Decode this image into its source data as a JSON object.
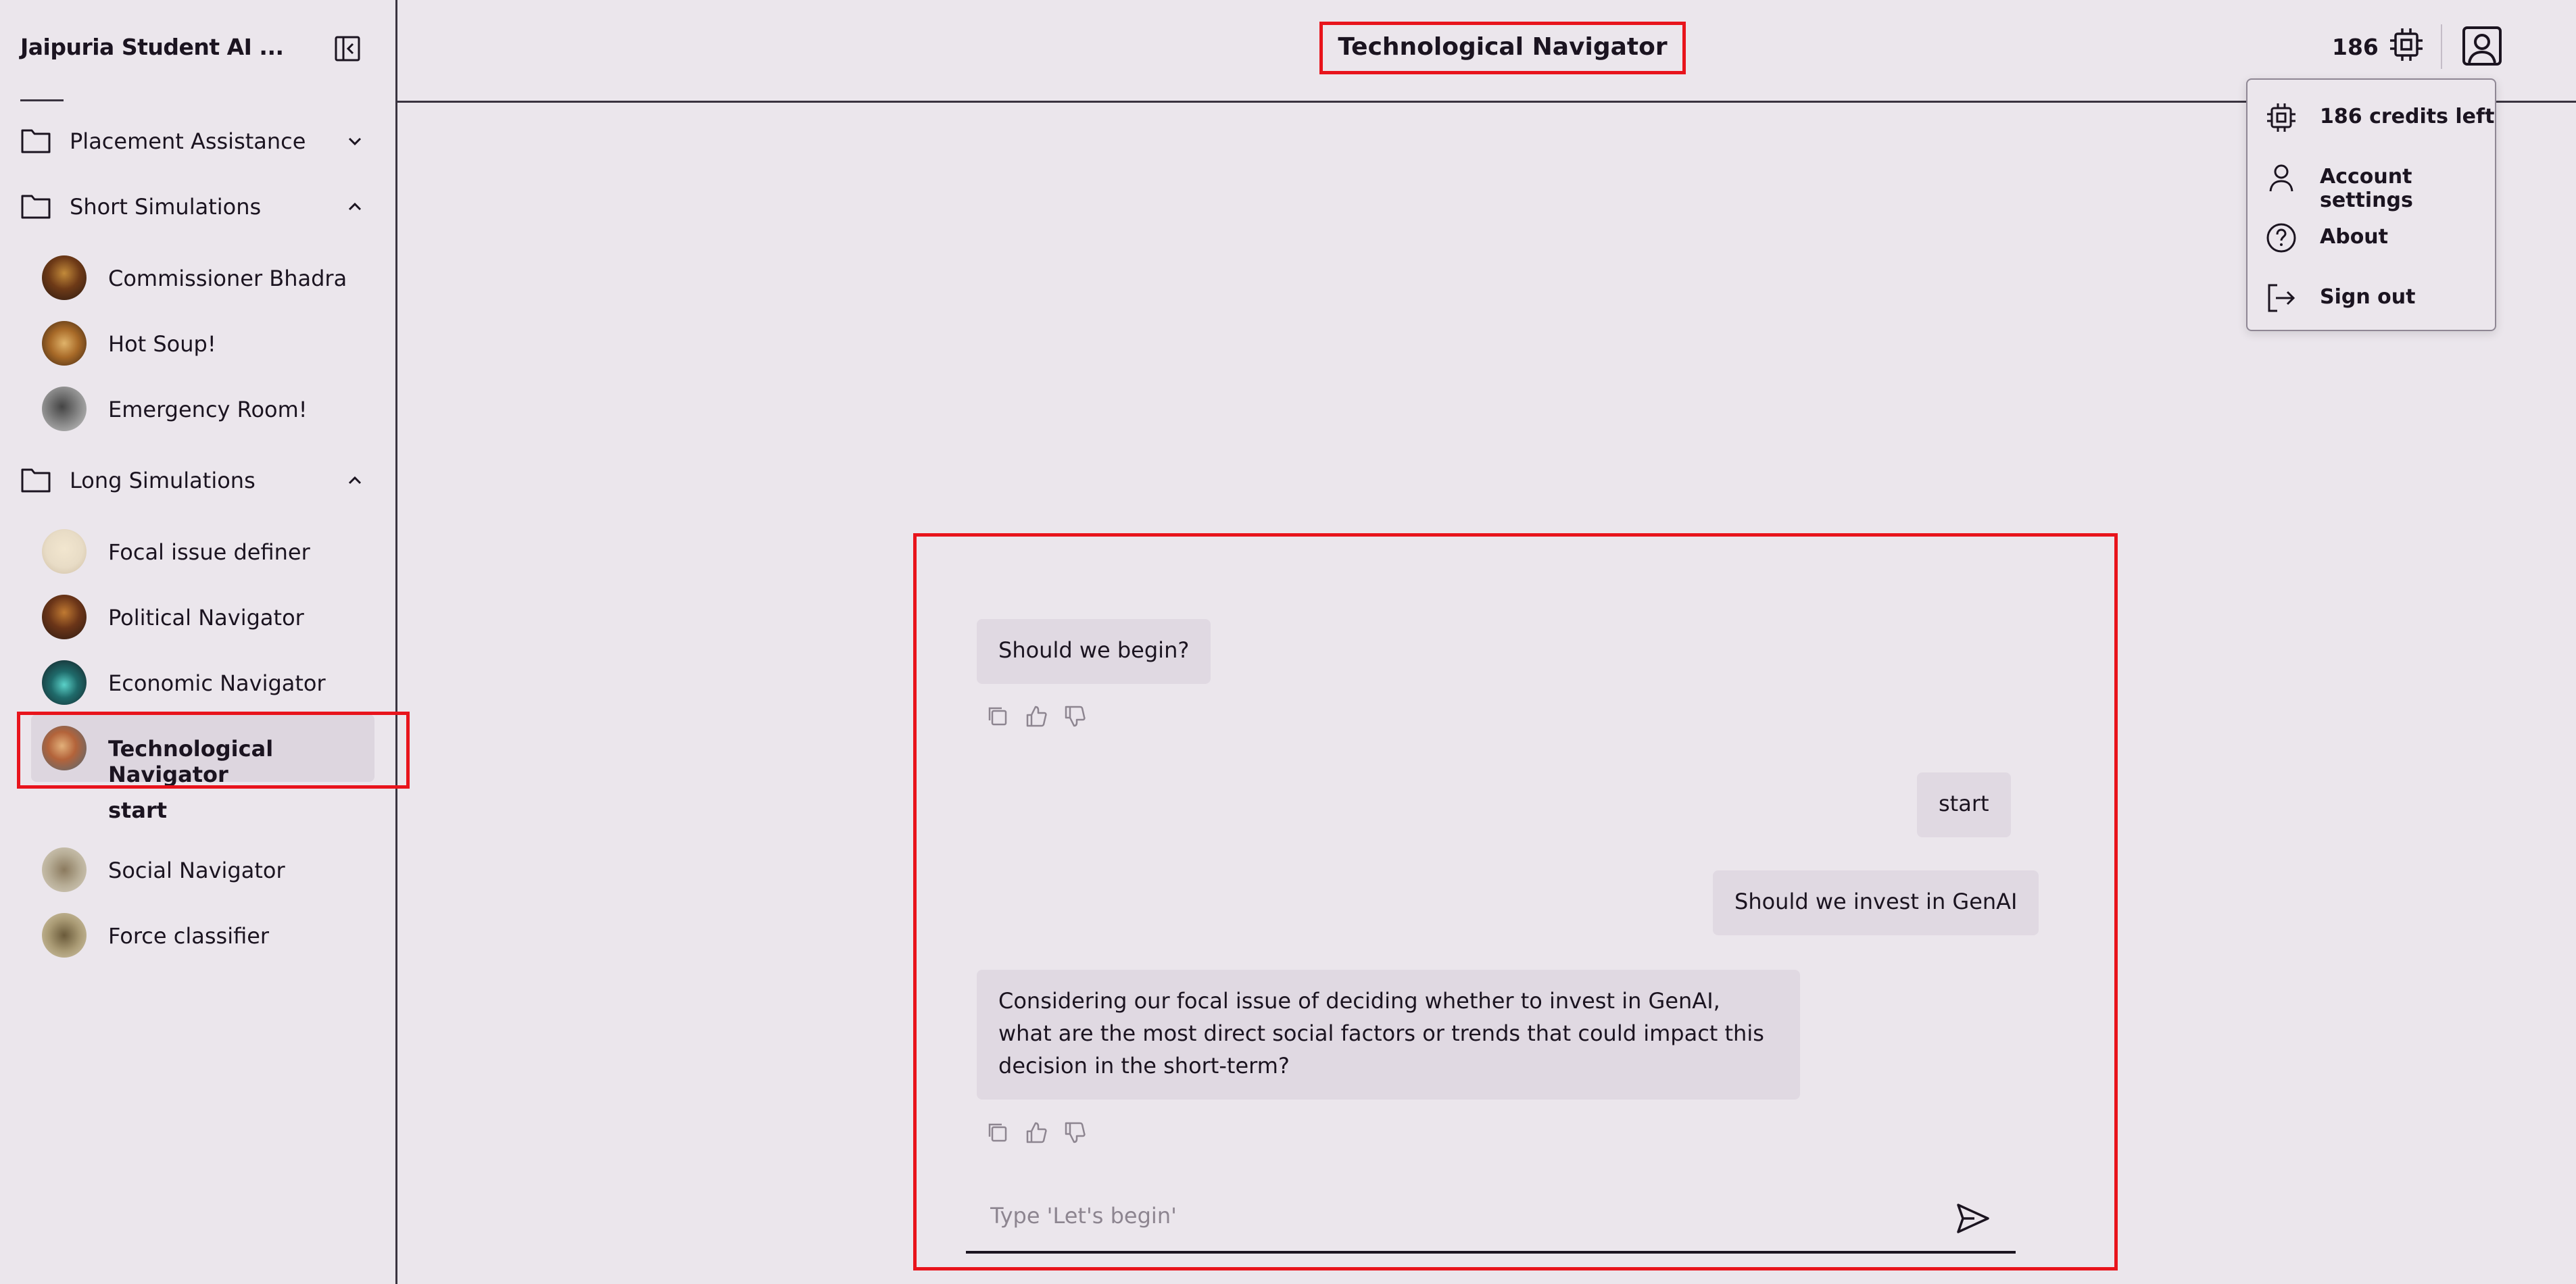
{
  "sidebar": {
    "app_title": "Jaipuria Student AI ...",
    "folders": [
      {
        "label": "Placement Assistance",
        "chevron": "chevron-down-icon"
      },
      {
        "label": "Short Simulations",
        "chevron": "chevron-up-icon"
      },
      {
        "label": "Long Simulations",
        "chevron": "chevron-up-icon"
      }
    ],
    "short_simulations": [
      {
        "label": "Commissioner Bhadra"
      },
      {
        "label": "Hot Soup!"
      },
      {
        "label": "Emergency Room!"
      }
    ],
    "long_simulations": [
      {
        "label": "Focal issue definer"
      },
      {
        "label": "Political Navigator"
      },
      {
        "label": "Economic Navigator"
      },
      {
        "label": "Technological Navigator",
        "active": true
      },
      {
        "label": "Social Navigator"
      },
      {
        "label": "Force classifier"
      }
    ],
    "active_sub_item": "start"
  },
  "header": {
    "title": "Technological Navigator",
    "credits_count": "186"
  },
  "account_menu": {
    "items": [
      {
        "label": "186 credits left",
        "icon": "chip-icon"
      },
      {
        "label": "Account settings",
        "icon": "user-icon"
      },
      {
        "label": "About",
        "icon": "help-circle-icon"
      },
      {
        "label": "Sign out",
        "icon": "sign-out-icon"
      }
    ]
  },
  "chat": {
    "messages": [
      {
        "role": "assistant",
        "text": "Should we begin?"
      },
      {
        "role": "user",
        "text": "start"
      },
      {
        "role": "user",
        "text": "Should we invest in GenAI"
      },
      {
        "role": "assistant",
        "text": "Considering our focal issue of deciding whether to invest in GenAI, what are the most direct social factors or trends that could impact this decision in the short-term?"
      }
    ],
    "input_placeholder": "Type 'Let's begin'",
    "input_value": ""
  },
  "colors": {
    "background": "#ebe6ec",
    "bubble": "#e0d9e2",
    "highlight_box": "#e8141c",
    "text": "#1b1420"
  }
}
